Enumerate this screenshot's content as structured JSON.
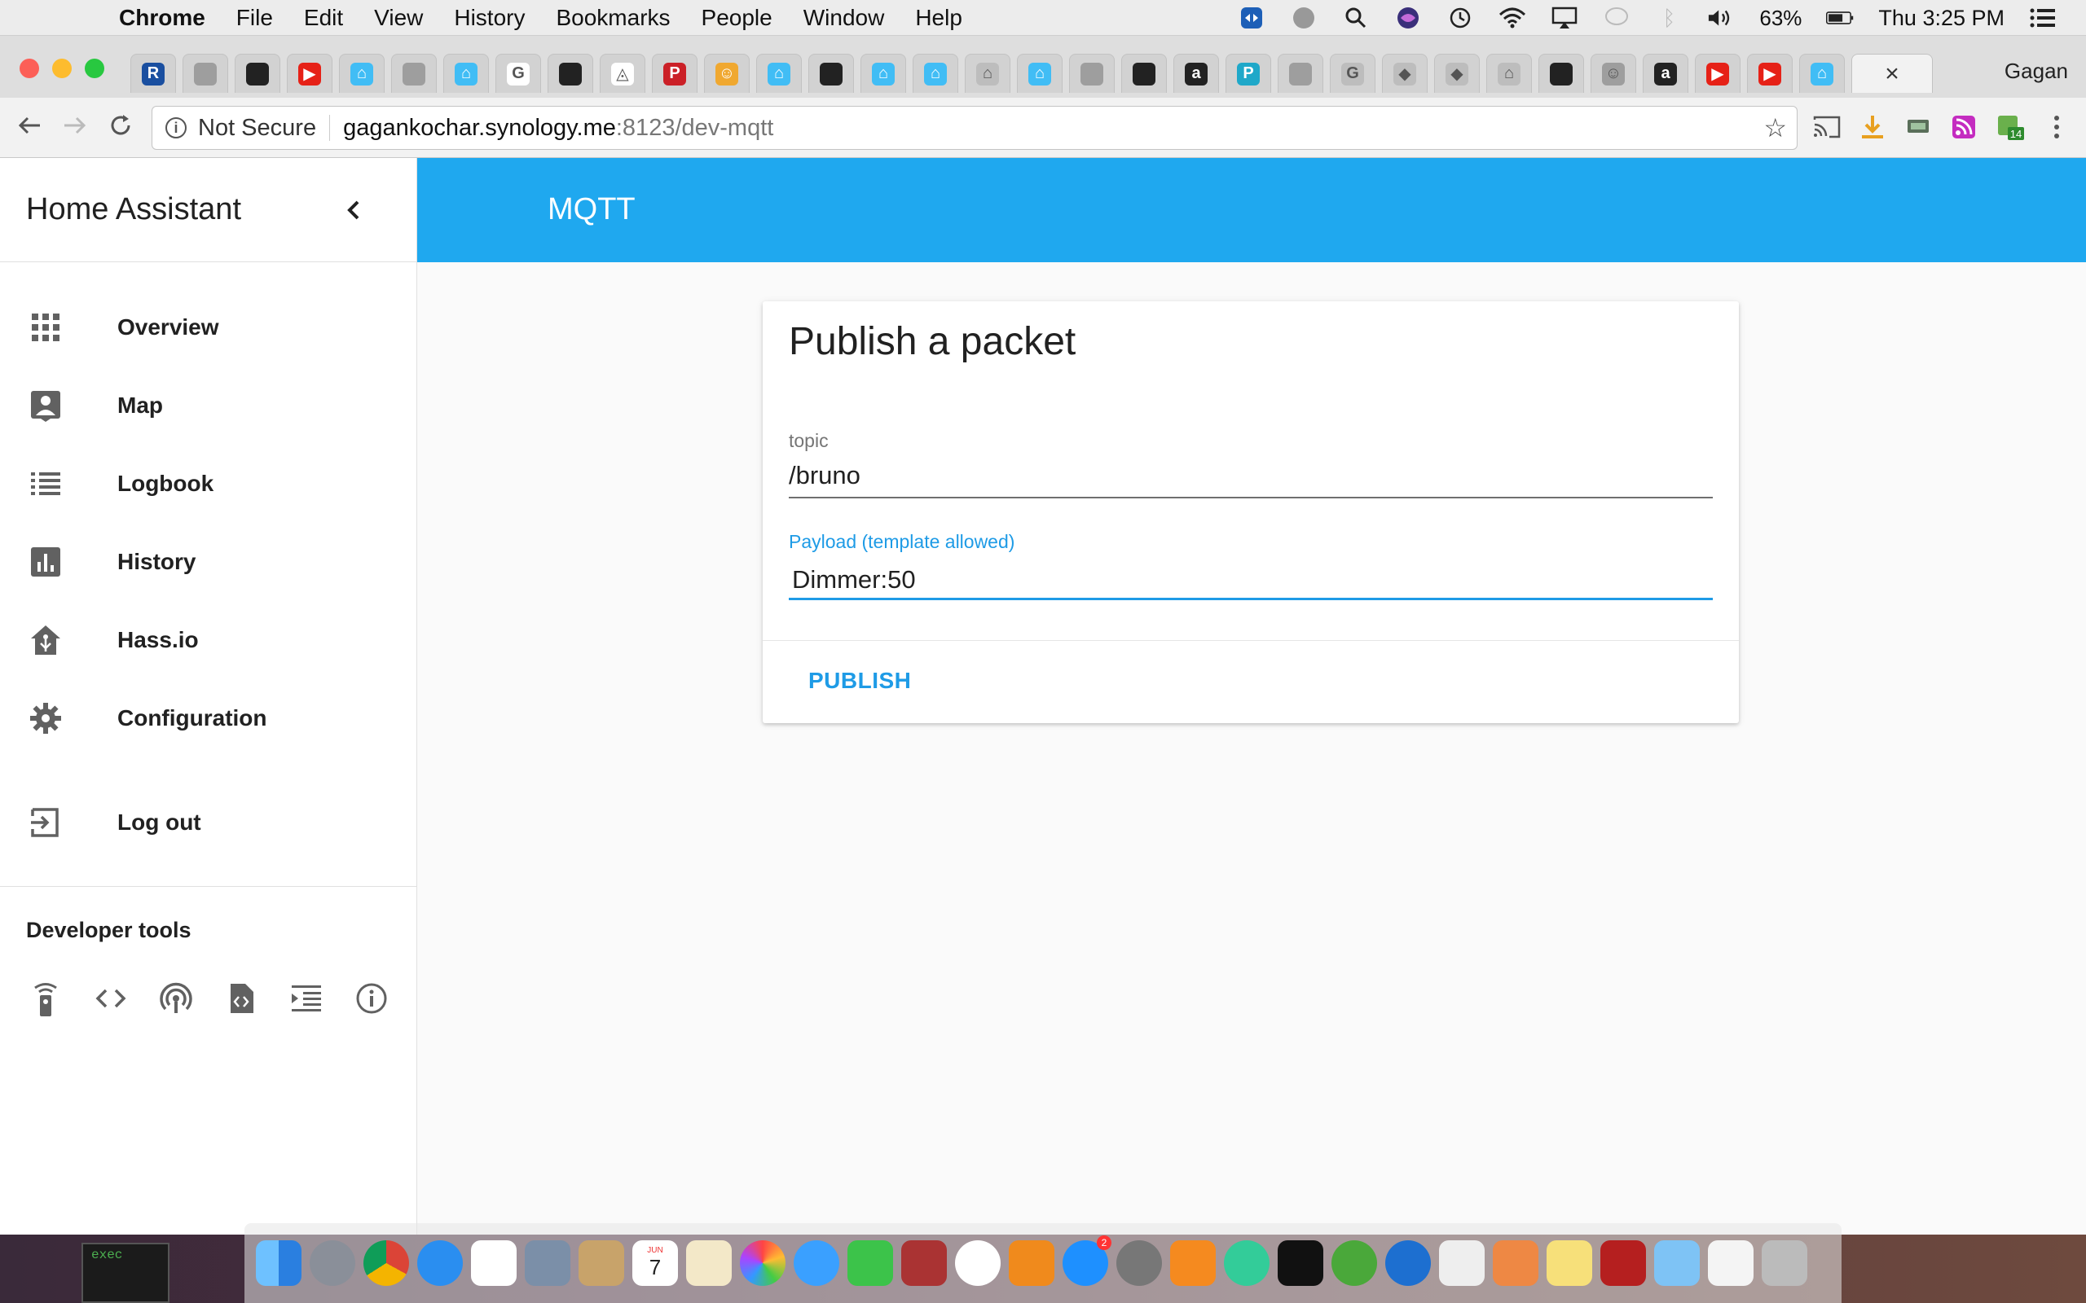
{
  "menubar": {
    "app_name": "Chrome",
    "menus": [
      "File",
      "Edit",
      "View",
      "History",
      "Bookmarks",
      "People",
      "Window",
      "Help"
    ],
    "battery": "63%",
    "clock": "Thu 3:25 PM"
  },
  "browser": {
    "profile_name": "Gagan",
    "security_label": "Not Secure",
    "url_host": "gagankochar.synology.me",
    "url_path": ":8123/dev-mqtt",
    "extension_badge": "14",
    "tabs": [
      {
        "icon": "r-icon",
        "color": "#1a4fa0",
        "glyph": "R"
      },
      {
        "icon": "page-icon",
        "color": "#9e9e9e",
        "glyph": ""
      },
      {
        "icon": "github-icon",
        "color": "#222222",
        "glyph": ""
      },
      {
        "icon": "youtube-icon",
        "color": "#e62117",
        "glyph": "▶"
      },
      {
        "icon": "home-assistant-icon",
        "color": "#41bdf5",
        "glyph": "⌂"
      },
      {
        "icon": "page-icon",
        "color": "#9e9e9e",
        "glyph": ""
      },
      {
        "icon": "home-assistant-icon",
        "color": "#41bdf5",
        "glyph": "⌂"
      },
      {
        "icon": "google-icon",
        "color": "#ffffff",
        "glyph": "G"
      },
      {
        "icon": "github-icon",
        "color": "#222222",
        "glyph": ""
      },
      {
        "icon": "openhab-icon",
        "color": "#ffffff",
        "glyph": "◬"
      },
      {
        "icon": "pinterest-icon",
        "color": "#cb2027",
        "glyph": "P"
      },
      {
        "icon": "avatar-icon",
        "color": "#f0a830",
        "glyph": "☺"
      },
      {
        "icon": "home-assistant-icon",
        "color": "#41bdf5",
        "glyph": "⌂"
      },
      {
        "icon": "github-icon",
        "color": "#222222",
        "glyph": ""
      },
      {
        "icon": "home-assistant-icon",
        "color": "#41bdf5",
        "glyph": "⌂"
      },
      {
        "icon": "home-assistant-icon",
        "color": "#41bdf5",
        "glyph": "⌂"
      },
      {
        "icon": "home-assistant-icon",
        "color": "#bdbdbd",
        "glyph": "⌂"
      },
      {
        "icon": "home-assistant-icon",
        "color": "#41bdf5",
        "glyph": "⌂"
      },
      {
        "icon": "page-icon",
        "color": "#9e9e9e",
        "glyph": ""
      },
      {
        "icon": "github-icon",
        "color": "#222222",
        "glyph": ""
      },
      {
        "icon": "amazon-icon",
        "color": "#222222",
        "glyph": "a"
      },
      {
        "icon": "paypal-icon",
        "color": "#1fa8c9",
        "glyph": "P"
      },
      {
        "icon": "page-icon",
        "color": "#9e9e9e",
        "glyph": ""
      },
      {
        "icon": "google-icon",
        "color": "#bdbdbd",
        "glyph": "G"
      },
      {
        "icon": "kodi-icon",
        "color": "#bdbdbd",
        "glyph": "◆"
      },
      {
        "icon": "kodi-icon",
        "color": "#bdbdbd",
        "glyph": "◆"
      },
      {
        "icon": "home-assistant-icon",
        "color": "#bdbdbd",
        "glyph": "⌂"
      },
      {
        "icon": "github-icon",
        "color": "#222222",
        "glyph": ""
      },
      {
        "icon": "avatar-icon",
        "color": "#9e9e9e",
        "glyph": "☺"
      },
      {
        "icon": "amazon-icon",
        "color": "#222222",
        "glyph": "a"
      },
      {
        "icon": "youtube-icon",
        "color": "#e62117",
        "glyph": "▶"
      },
      {
        "icon": "youtube-icon",
        "color": "#e62117",
        "glyph": "▶"
      },
      {
        "icon": "home-assistant-icon",
        "color": "#41bdf5",
        "glyph": "⌂"
      }
    ],
    "active_tab_close": "×"
  },
  "sidebar": {
    "title": "Home Assistant",
    "items": [
      {
        "label": "Overview",
        "icon": "grid-icon"
      },
      {
        "label": "Map",
        "icon": "map-account-icon"
      },
      {
        "label": "Logbook",
        "icon": "list-icon"
      },
      {
        "label": "History",
        "icon": "chart-icon"
      },
      {
        "label": "Hass.io",
        "icon": "hassio-icon"
      },
      {
        "label": "Configuration",
        "icon": "gear-icon"
      }
    ],
    "logout_label": "Log out",
    "dev_tools_title": "Developer tools",
    "dev_tools": [
      "remote-icon",
      "code-icon",
      "broadcast-icon",
      "file-code-icon",
      "format-indent-icon",
      "info-icon"
    ]
  },
  "header": {
    "title": "MQTT",
    "color": "#1fa8ef"
  },
  "card": {
    "title": "Publish a packet",
    "topic_label": "topic",
    "topic_value": "/bruno",
    "payload_label": "Payload (template allowed)",
    "payload_value": "Dimmer:50",
    "publish_label": "PUBLISH",
    "accent": "#1e9be6"
  },
  "dock": {
    "exec_label": "exec",
    "appstore_badge": "2",
    "calendar_month": "JUN",
    "calendar_day": "7"
  }
}
